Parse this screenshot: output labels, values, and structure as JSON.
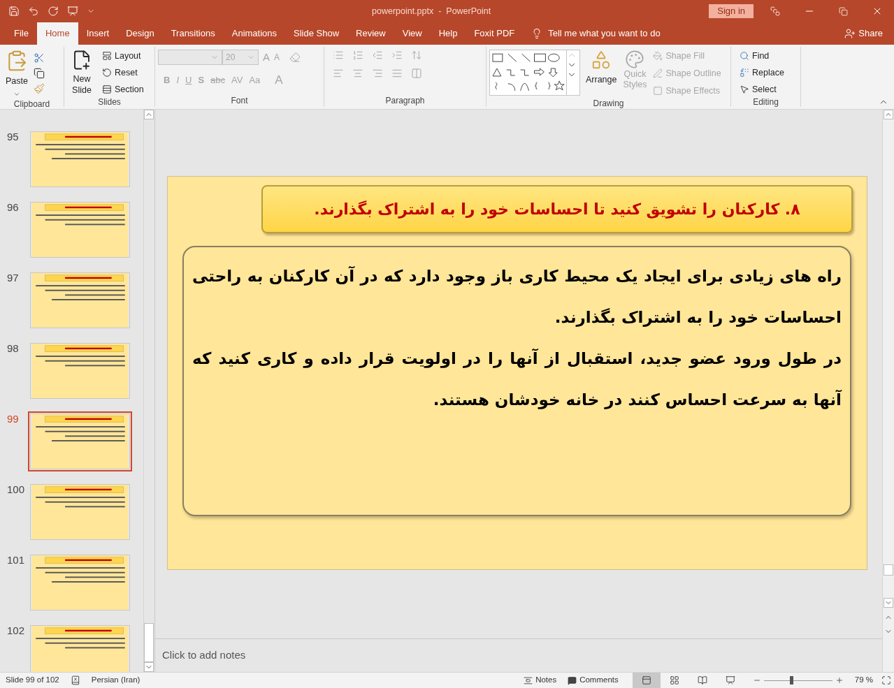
{
  "window": {
    "title": "powerpoint.pptx  -  PowerPoint",
    "sign_in": "Sign in"
  },
  "tabs": [
    {
      "label": "File",
      "selected": false
    },
    {
      "label": "Home",
      "selected": true
    },
    {
      "label": "Insert",
      "selected": false
    },
    {
      "label": "Design",
      "selected": false
    },
    {
      "label": "Transitions",
      "selected": false
    },
    {
      "label": "Animations",
      "selected": false
    },
    {
      "label": "Slide Show",
      "selected": false
    },
    {
      "label": "Review",
      "selected": false
    },
    {
      "label": "View",
      "selected": false
    },
    {
      "label": "Help",
      "selected": false
    },
    {
      "label": "Foxit PDF",
      "selected": false
    }
  ],
  "tell_me": "Tell me what you want to do",
  "share": "Share",
  "ribbon": {
    "clipboard": {
      "label": "Clipboard",
      "paste": "Paste"
    },
    "slides": {
      "label": "Slides",
      "new_slide": "New Slide",
      "items": [
        "Layout",
        "Reset",
        "Section"
      ]
    },
    "font": {
      "label": "Font",
      "size": "20",
      "size_buttons": [
        "A",
        "A"
      ],
      "format_buttons": [
        "B",
        "I",
        "U",
        "S",
        "abc",
        "AV",
        "Aa",
        "A"
      ],
      "disabled": true
    },
    "paragraph": {
      "label": "Paragraph"
    },
    "drawing": {
      "label": "Drawing",
      "arrange": "Arrange",
      "styles": [
        {
          "label": "Quick Styles",
          "disabled": true
        }
      ],
      "shape_items": [
        {
          "label": "Shape Fill",
          "disabled": true
        },
        {
          "label": "Shape Outline",
          "disabled": true
        },
        {
          "label": "Shape Effects",
          "disabled": true
        }
      ]
    },
    "editing": {
      "label": "Editing",
      "items": [
        "Find",
        "Replace",
        "Select"
      ]
    }
  },
  "thumbnails": [
    {
      "number": "95",
      "selected": false
    },
    {
      "number": "96",
      "selected": false
    },
    {
      "number": "97",
      "selected": false
    },
    {
      "number": "98",
      "selected": false
    },
    {
      "number": "99",
      "selected": true
    },
    {
      "number": "100",
      "selected": false
    },
    {
      "number": "101",
      "selected": false
    },
    {
      "number": "102",
      "selected": false
    }
  ],
  "slide": {
    "title": "۸. کارکنان را تشویق کنید تا احساسات خود را به اشتراک بگذارند.",
    "paragraphs": [
      "راه های زیادی برای ایجاد یک محیط کاری باز وجود دارد که در آن کارکنان به راحتی احساسات خود را به اشتراک بگذارند.",
      "در طول ورود عضو جدید، استقبال از آنها را در اولویت قرار داده و کاری کنید که آنها به سرعت احساس کنند در خانه خودشان هستند."
    ]
  },
  "notes": {
    "placeholder": "Click to add notes"
  },
  "status_bar": {
    "slide": "Slide 99 of 102",
    "language": "Persian (Iran)",
    "notes": "Notes",
    "comments": "Comments",
    "views": [
      {
        "kind": "normal",
        "selected": true
      },
      {
        "kind": "sorter",
        "selected": false
      },
      {
        "kind": "reading",
        "selected": false
      },
      {
        "kind": "slideshow",
        "selected": false
      }
    ],
    "zoom": {
      "level": 0.4,
      "reading": "79 %"
    }
  }
}
